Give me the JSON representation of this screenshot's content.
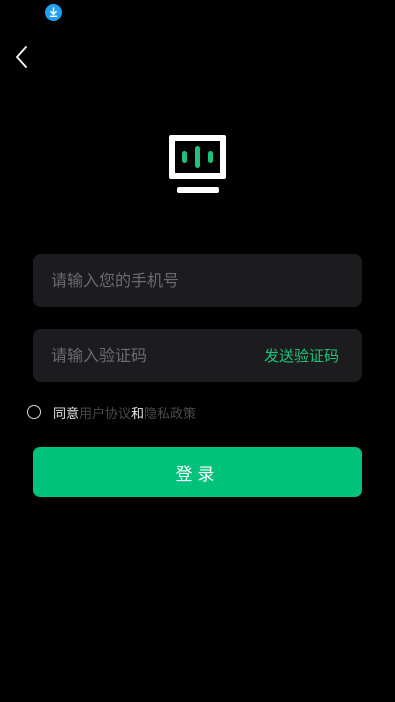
{
  "status_bar": {
    "download_icon": "download-icon",
    "download_color": "#1ea1f2"
  },
  "nav": {
    "back_icon": "chevron-left-icon"
  },
  "logo": {
    "icon": "tv-logo-icon",
    "accent": "#1ec27a"
  },
  "form": {
    "phone_placeholder": "请输入您的手机号",
    "code_placeholder": "请输入验证码",
    "send_code_label": "发送验证码",
    "agree_prefix": "同意",
    "user_agreement": "用户协议",
    "and": "和",
    "privacy_policy": "隐私政策",
    "agree_checked": false,
    "login_label": "登录"
  },
  "colors": {
    "background": "#000000",
    "field_bg": "#1c1c1e",
    "accent": "#00c27a",
    "link_dim": "#4a4a4a"
  }
}
